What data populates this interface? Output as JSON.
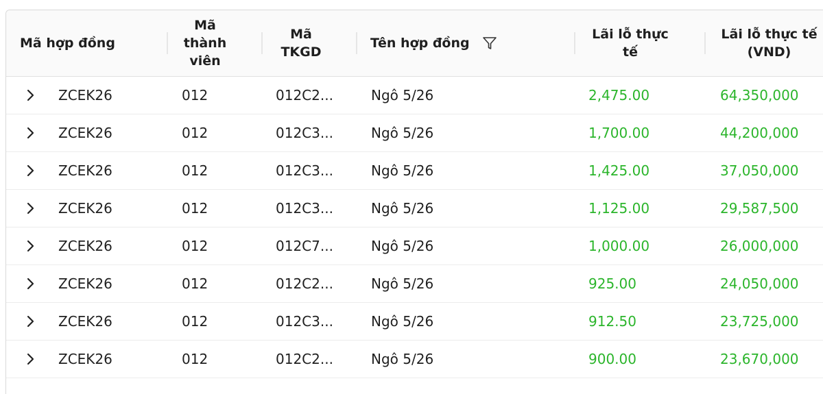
{
  "table": {
    "headers": {
      "contract_code": "Mã hợp đồng",
      "member_code": "Mã\nthành\nviên",
      "tkgd_code": "Mã\nTKGD",
      "contract_name": "Tên hợp đồng",
      "actual_pl": "Lãi lỗ thực\ntế",
      "actual_pl_vnd": "Lãi lỗ thực tế\n(VND)"
    },
    "filter_icon": "filter-icon",
    "expand_icon": "chevron-right-icon",
    "colors": {
      "positive_value": "#2bb52b",
      "header_bg": "#fafafa"
    },
    "rows": [
      {
        "contract_code": "ZCEK26",
        "member_code": "012",
        "tkgd_code": "012C2...",
        "contract_name": "Ngô 5/26",
        "actual_pl": "2,475.00",
        "actual_pl_vnd": "64,350,000"
      },
      {
        "contract_code": "ZCEK26",
        "member_code": "012",
        "tkgd_code": "012C3...",
        "contract_name": "Ngô 5/26",
        "actual_pl": "1,700.00",
        "actual_pl_vnd": "44,200,000"
      },
      {
        "contract_code": "ZCEK26",
        "member_code": "012",
        "tkgd_code": "012C3...",
        "contract_name": "Ngô 5/26",
        "actual_pl": "1,425.00",
        "actual_pl_vnd": "37,050,000"
      },
      {
        "contract_code": "ZCEK26",
        "member_code": "012",
        "tkgd_code": "012C3...",
        "contract_name": "Ngô 5/26",
        "actual_pl": "1,125.00",
        "actual_pl_vnd": "29,587,500"
      },
      {
        "contract_code": "ZCEK26",
        "member_code": "012",
        "tkgd_code": "012C7...",
        "contract_name": "Ngô 5/26",
        "actual_pl": "1,000.00",
        "actual_pl_vnd": "26,000,000"
      },
      {
        "contract_code": "ZCEK26",
        "member_code": "012",
        "tkgd_code": "012C2...",
        "contract_name": "Ngô 5/26",
        "actual_pl": "925.00",
        "actual_pl_vnd": "24,050,000"
      },
      {
        "contract_code": "ZCEK26",
        "member_code": "012",
        "tkgd_code": "012C3...",
        "contract_name": "Ngô 5/26",
        "actual_pl": "912.50",
        "actual_pl_vnd": "23,725,000"
      },
      {
        "contract_code": "ZCEK26",
        "member_code": "012",
        "tkgd_code": "012C2...",
        "contract_name": "Ngô 5/26",
        "actual_pl": "900.00",
        "actual_pl_vnd": "23,670,000"
      }
    ]
  }
}
